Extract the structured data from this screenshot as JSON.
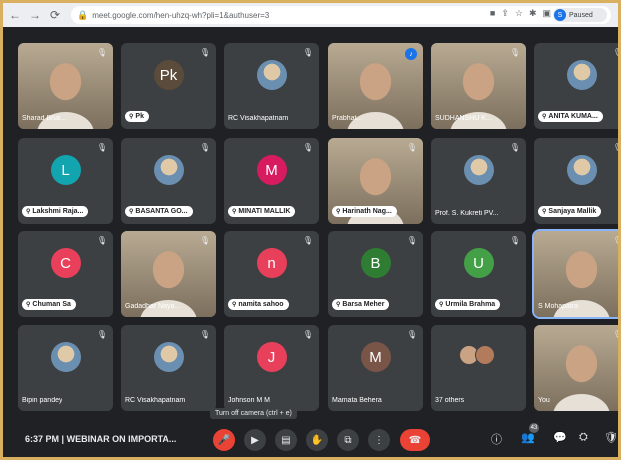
{
  "browser": {
    "url": "meet.google.com/hen-uhzq-wh?pli=1&authuser=3",
    "profile_label": "Paused",
    "profile_initial": "S"
  },
  "tiles": [
    {
      "name": "Sharad Bhal...",
      "kind": "video",
      "style": "plain"
    },
    {
      "name": "Pk",
      "kind": "letter",
      "letter": "Pk",
      "color": "#5b4b3a",
      "style": "pill"
    },
    {
      "name": "RC Visakhapatnam",
      "kind": "photo",
      "style": "plain"
    },
    {
      "name": "Prabhat...",
      "kind": "video",
      "style": "plain",
      "speaking": true
    },
    {
      "name": "SUDHANSHU K...",
      "kind": "video",
      "style": "plain"
    },
    {
      "name": "ANITA KUMA...",
      "kind": "photo",
      "style": "pill"
    },
    {
      "name": "Lakshmi Raja...",
      "kind": "letter",
      "letter": "L",
      "color": "#12a4af",
      "style": "pill"
    },
    {
      "name": "BASANTA GO...",
      "kind": "photo",
      "style": "pill"
    },
    {
      "name": "MINATI MALLIK",
      "kind": "letter",
      "letter": "M",
      "color": "#d81b60",
      "style": "pill"
    },
    {
      "name": "Harinath Nag...",
      "kind": "video",
      "style": "pill"
    },
    {
      "name": "Prof. S. Kukreti PV...",
      "kind": "photo",
      "style": "plain"
    },
    {
      "name": "Sanjaya Mallik",
      "kind": "photo",
      "style": "pill"
    },
    {
      "name": "Chuman Sa",
      "kind": "letter",
      "letter": "C",
      "color": "#e8405b",
      "style": "pill"
    },
    {
      "name": "Gadadhar Naya...",
      "kind": "video",
      "style": "plain"
    },
    {
      "name": "namita sahoo",
      "kind": "letter",
      "letter": "n",
      "color": "#e8405b",
      "style": "pill"
    },
    {
      "name": "Barsa Meher",
      "kind": "letter",
      "letter": "B",
      "color": "#2e7d32",
      "style": "pill"
    },
    {
      "name": "Urmila Brahma",
      "kind": "letter",
      "letter": "U",
      "color": "#43a047",
      "style": "pill"
    },
    {
      "name": "S Mohapatra",
      "kind": "video",
      "style": "plain",
      "highlight": true
    },
    {
      "name": "Bipin pandey",
      "kind": "photo",
      "style": "plain"
    },
    {
      "name": "RC Visakhapatnam",
      "kind": "photo",
      "style": "plain"
    },
    {
      "name": "Johnson M M",
      "kind": "letter",
      "letter": "J",
      "color": "#e8405b",
      "style": "plain"
    },
    {
      "name": "Mamata Behera",
      "kind": "letter",
      "letter": "M",
      "color": "#795548",
      "style": "plain"
    },
    {
      "name": "37 others",
      "kind": "others",
      "style": "plain"
    },
    {
      "name": "You",
      "kind": "video",
      "style": "plain"
    }
  ],
  "tooltip": "Turn off camera (ctrl + e)",
  "bottom": {
    "time": "6:37 PM",
    "separator": "|",
    "meeting_title": "WEBINAR ON IMPORTA...",
    "participants_badge": "43"
  },
  "colors": {
    "accent": "#1a73e8",
    "danger": "#ea4335",
    "tile": "#3c4043",
    "background": "#202124"
  }
}
